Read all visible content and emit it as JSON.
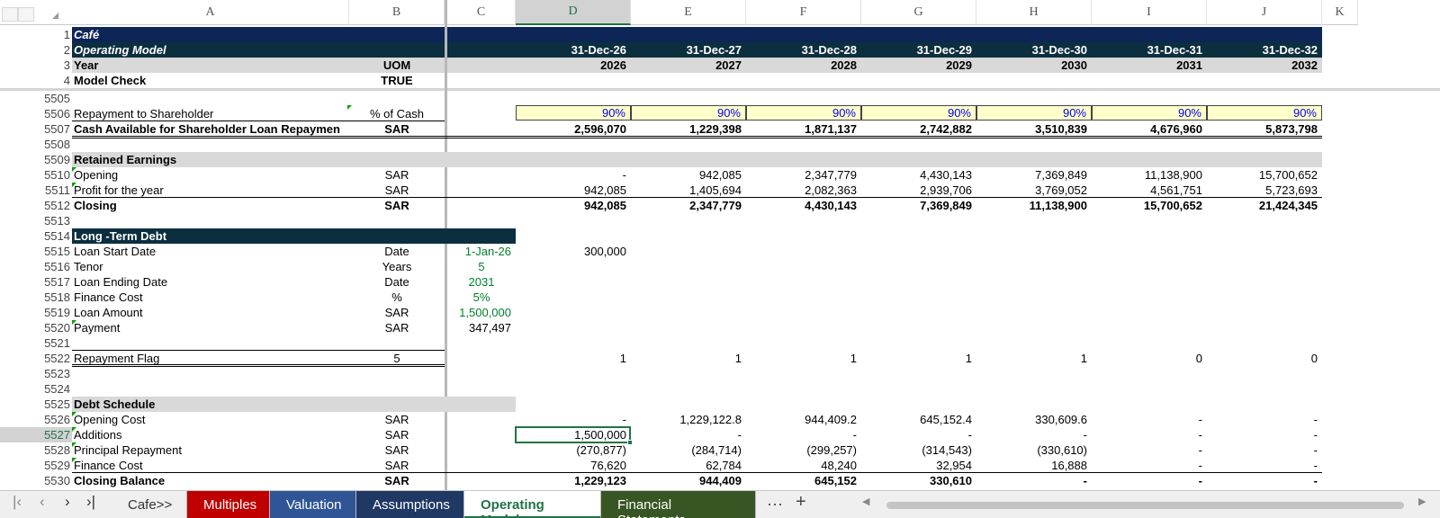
{
  "columns": [
    "A",
    "B",
    "C",
    "D",
    "E",
    "F",
    "G",
    "H",
    "I",
    "J",
    "K"
  ],
  "header": {
    "row1": {
      "num": "1",
      "label": "Café"
    },
    "row2": {
      "num": "2",
      "label": "Operating Model",
      "dates": [
        "31-Dec-26",
        "31-Dec-27",
        "31-Dec-28",
        "31-Dec-29",
        "31-Dec-30",
        "31-Dec-31",
        "31-Dec-32"
      ]
    },
    "row3": {
      "num": "3",
      "label": "Year",
      "uom": "UOM",
      "years": [
        "2026",
        "2027",
        "2028",
        "2029",
        "2030",
        "2031",
        "2032"
      ]
    },
    "row4": {
      "num": "4",
      "label": "Model Check",
      "value": "TRUE"
    }
  },
  "rows": {
    "r5505": {
      "num": "5505"
    },
    "r5506": {
      "num": "5506",
      "label": "Repayment to Shareholder",
      "uom": "% of Cash",
      "vals": [
        "90%",
        "90%",
        "90%",
        "90%",
        "90%",
        "90%",
        "90%"
      ]
    },
    "r5507": {
      "num": "5507",
      "label": "Cash Available for Shareholder Loan Repaymen",
      "uom": "SAR",
      "vals": [
        "2,596,070",
        "1,229,398",
        "1,871,137",
        "2,742,882",
        "3,510,839",
        "4,676,960",
        "5,873,798"
      ]
    },
    "r5508": {
      "num": "5508"
    },
    "r5509": {
      "num": "5509",
      "label": "Retained Earnings"
    },
    "r5510": {
      "num": "5510",
      "label": "Opening",
      "uom": "SAR",
      "vals": [
        "-",
        "942,085",
        "2,347,779",
        "4,430,143",
        "7,369,849",
        "11,138,900",
        "15,700,652"
      ]
    },
    "r5511": {
      "num": "5511",
      "label": "Profit for the year",
      "uom": "SAR",
      "vals": [
        "942,085",
        "1,405,694",
        "2,082,363",
        "2,939,706",
        "3,769,052",
        "4,561,751",
        "5,723,693"
      ]
    },
    "r5512": {
      "num": "5512",
      "label": "Closing",
      "uom": "SAR",
      "vals": [
        "942,085",
        "2,347,779",
        "4,430,143",
        "7,369,849",
        "11,138,900",
        "15,700,652",
        "21,424,345"
      ]
    },
    "r5513": {
      "num": "5513"
    },
    "r5514": {
      "num": "5514",
      "label": "Long -Term Debt"
    },
    "r5515": {
      "num": "5515",
      "label": "Loan Start Date",
      "uom": "Date",
      "c": "1-Jan-26",
      "d": "300,000"
    },
    "r5516": {
      "num": "5516",
      "label": "Tenor",
      "uom": "Years",
      "c": "5"
    },
    "r5517": {
      "num": "5517",
      "label": "Loan Ending Date",
      "uom": "Date",
      "c": "2031"
    },
    "r5518": {
      "num": "5518",
      "label": "Finance Cost",
      "uom": "%",
      "c": "5%"
    },
    "r5519": {
      "num": "5519",
      "label": "Loan Amount",
      "uom": "SAR",
      "c": "1,500,000"
    },
    "r5520": {
      "num": "5520",
      "label": "Payment",
      "uom": "SAR",
      "c": "347,497"
    },
    "r5521": {
      "num": "5521"
    },
    "r5522": {
      "num": "5522",
      "label": "Repayment Flag",
      "uom": "5",
      "vals": [
        "1",
        "1",
        "1",
        "1",
        "1",
        "0",
        "0"
      ]
    },
    "r5523": {
      "num": "5523"
    },
    "r5524": {
      "num": "5524"
    },
    "r5525": {
      "num": "5525",
      "label": "Debt Schedule"
    },
    "r5526": {
      "num": "5526",
      "label": "Opening Cost",
      "uom": "SAR",
      "vals": [
        "-",
        "1,229,122.8",
        "944,409.2",
        "645,152.4",
        "330,609.6",
        "-",
        "-"
      ]
    },
    "r5527": {
      "num": "5527",
      "label": "Additions",
      "uom": "SAR",
      "vals": [
        "1,500,000",
        "-",
        "-",
        "-",
        "-",
        "-",
        "-"
      ]
    },
    "r5528": {
      "num": "5528",
      "label": "Principal Repayment",
      "uom": "SAR",
      "vals": [
        "(270,877)",
        "(284,714)",
        "(299,257)",
        "(314,543)",
        "(330,610)",
        "-",
        "-"
      ]
    },
    "r5529": {
      "num": "5529",
      "label": "Finance Cost",
      "uom": "SAR",
      "vals": [
        "76,620",
        "62,784",
        "48,240",
        "32,954",
        "16,888",
        "-",
        "-"
      ]
    },
    "r5530": {
      "num": "5530",
      "label": "Closing Balance",
      "uom": "SAR",
      "vals": [
        "1,229,123",
        "944,409",
        "645,152",
        "330,610",
        "-",
        "-",
        "-"
      ]
    }
  },
  "tabs": [
    "Cafe>>",
    "Multiples",
    "Valuation",
    "Assumptions",
    "Operating Model",
    "Financial Statements"
  ],
  "tab_colors": {
    "Multiples": "#c00000",
    "Valuation": "#2f5597",
    "Assumptions": "#1f3864",
    "Operating Model": "#ffffff",
    "Financial Statements": "#375623"
  },
  "tabbar": {
    "more": "···",
    "add": "+"
  },
  "accent": "#217346"
}
